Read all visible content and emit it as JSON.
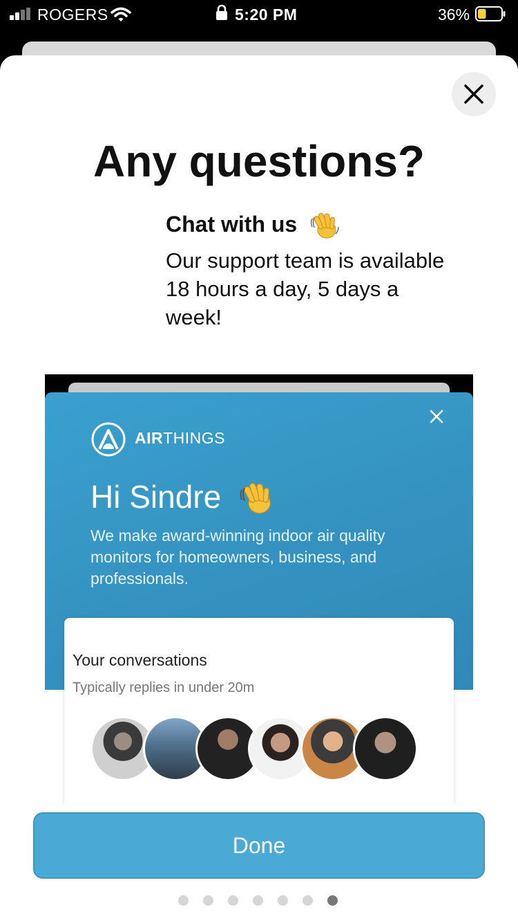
{
  "status_bar": {
    "carrier": "ROGERS",
    "time": "5:20 PM",
    "battery_percent": "36%",
    "signal_bars_active": 2,
    "signal_bars_total": 4,
    "battery_level": 0.36,
    "battery_color": "#f7d230"
  },
  "modal": {
    "title": "Any questions?",
    "subtitle": "Chat with us",
    "subtitle_icon": "waving-hand-icon",
    "body": "Our support team is available 18 hours a day, 5 days a week!",
    "close_icon": "close-icon"
  },
  "preview": {
    "brand_bold": "AIR",
    "brand_rest": "THINGS",
    "greeting": "Hi Sindre",
    "intro": "We make award-winning indoor air quality monitors for homeowners, business, and professionals.",
    "conversations_title": "Your conversations",
    "conversations_subtitle": "Typically replies in under 20m",
    "header_color": "#3a9bcb",
    "avatar_count": 6
  },
  "done_button": {
    "label": "Done",
    "color": "#4aa9d5"
  },
  "pagination": {
    "total": 7,
    "active_index": 6
  }
}
